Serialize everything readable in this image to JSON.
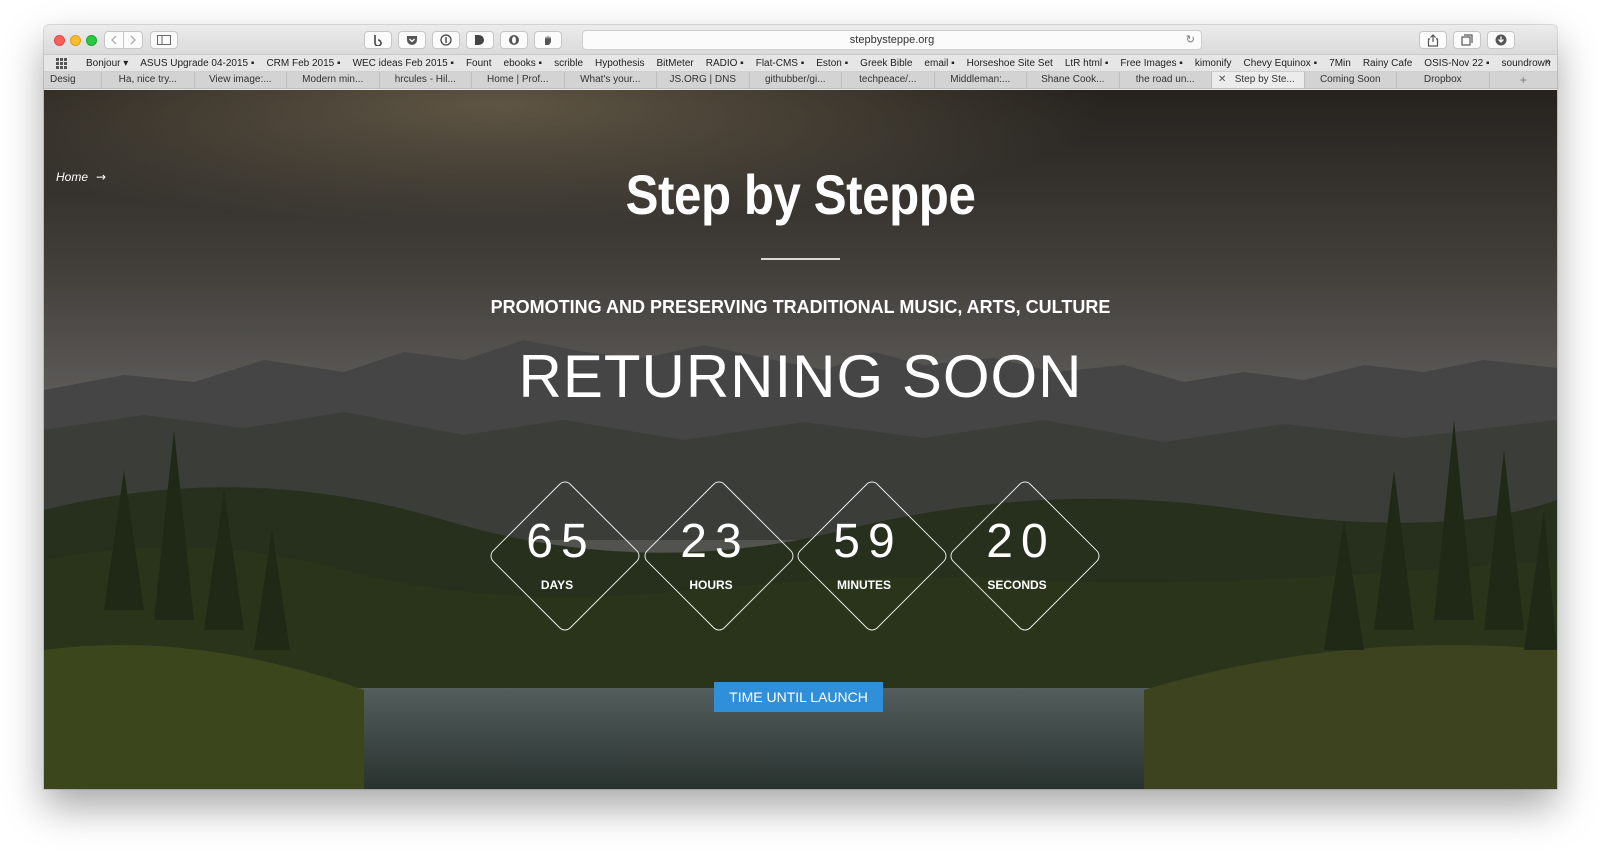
{
  "browser": {
    "url": "stepbysteppe.org",
    "bookmarks": [
      "Bonjour ▾",
      "ASUS Upgrade 04-2015 ▪",
      "CRM Feb 2015 ▪",
      "WEC ideas Feb 2015 ▪",
      "Fount",
      "ebooks ▪",
      "scrible",
      "Hypothesis",
      "BitMeter",
      "RADIO ▪",
      "Flat-CMS ▪",
      "Eston ▪",
      "Greek Bible",
      "email ▪",
      "Horseshoe Site Set",
      "LtR html ▪",
      "Free Images ▪",
      "kimonify",
      "Chevy Equinox ▪",
      "7Min",
      "Rainy Cafe",
      "OSIS-Nov 22 ▪",
      "soundrown"
    ],
    "tabs": [
      "Desig",
      "Ha, nice try...",
      "View image:...",
      "Modern min...",
      "hrcules - Hil...",
      "Home | Prof...",
      "What's your...",
      "JS.ORG | DNS",
      "githubber/gi...",
      "techpeace/...",
      "Middleman:...",
      "Shane Cook...",
      "the road un...",
      "Step by Ste...",
      "Coming Soon",
      "Dropbox"
    ],
    "active_tab_index": 13
  },
  "page": {
    "home_link": "Home",
    "title": "Step by Steppe",
    "subtitle": "PROMOTING AND PRESERVING TRADITIONAL MUSIC, ARTS, CULTURE",
    "headline": "RETURNING SOON",
    "countdown": [
      {
        "value": "65",
        "label": "DAYS"
      },
      {
        "value": "23",
        "label": "HOURS"
      },
      {
        "value": "59",
        "label": "MINUTES"
      },
      {
        "value": "20",
        "label": "SECONDS"
      }
    ],
    "button": "TIME UNTIL LAUNCH"
  },
  "colors": {
    "accent": "#2f8fd8"
  }
}
